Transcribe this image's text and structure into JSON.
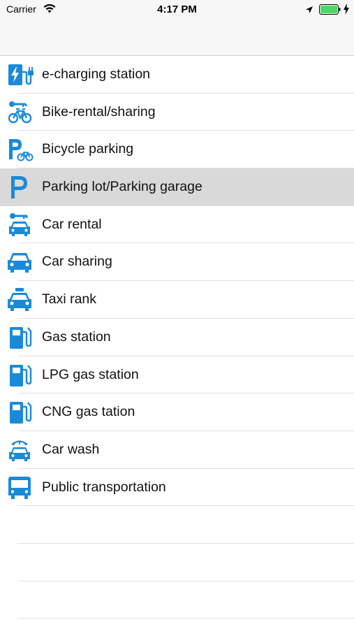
{
  "status_bar": {
    "carrier": "Carrier",
    "time": "4:17 PM",
    "icons": [
      "wifi-icon",
      "location-arrow-icon",
      "battery-icon",
      "charging-bolt-icon"
    ],
    "battery_color": "#4cd964"
  },
  "accent_color": "#1a8ad8",
  "items": [
    {
      "label": "e-charging station",
      "icon": "e-charging-station-icon",
      "selected": false
    },
    {
      "label": "Bike-rental/sharing",
      "icon": "bike-rental-icon",
      "selected": false
    },
    {
      "label": "Bicycle parking",
      "icon": "bicycle-parking-icon",
      "selected": false
    },
    {
      "label": "Parking lot/Parking garage",
      "icon": "parking-icon",
      "selected": true
    },
    {
      "label": "Car rental",
      "icon": "car-rental-icon",
      "selected": false
    },
    {
      "label": "Car sharing",
      "icon": "car-sharing-icon",
      "selected": false
    },
    {
      "label": "Taxi rank",
      "icon": "taxi-icon",
      "selected": false
    },
    {
      "label": "Gas station",
      "icon": "gas-station-icon",
      "selected": false
    },
    {
      "label": "LPG gas station",
      "icon": "lpg-gas-station-icon",
      "selected": false
    },
    {
      "label": "CNG gas tation",
      "icon": "cng-gas-station-icon",
      "selected": false
    },
    {
      "label": "Car wash",
      "icon": "car-wash-icon",
      "selected": false
    },
    {
      "label": "Public transportation",
      "icon": "bus-icon",
      "selected": false
    }
  ]
}
